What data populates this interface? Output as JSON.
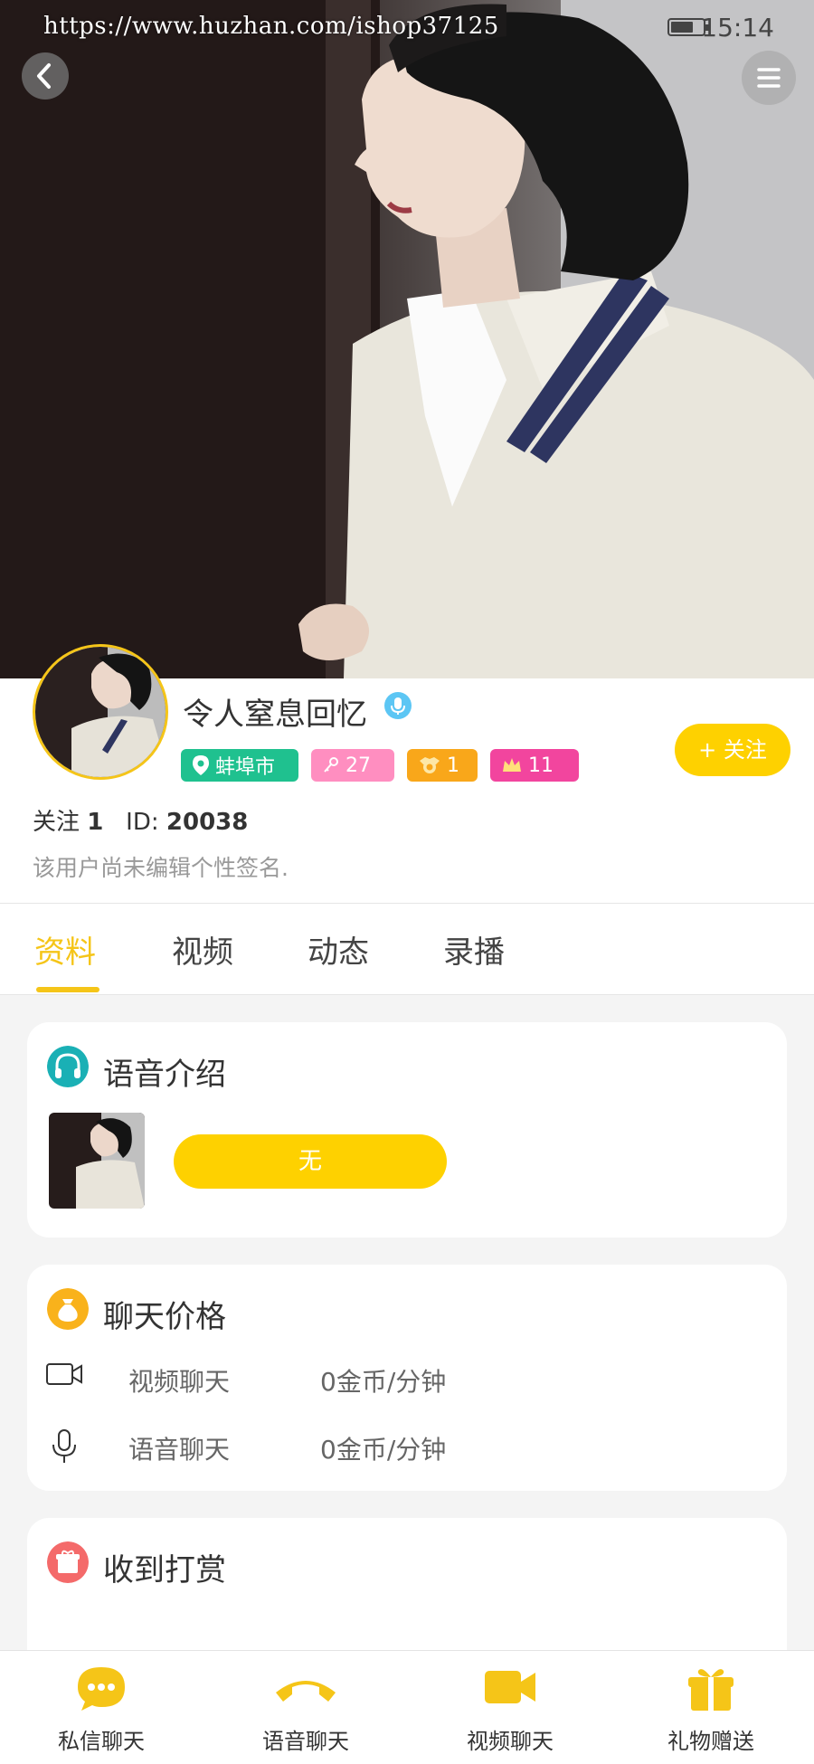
{
  "status_bar": {
    "url_watermark": "https://www.huzhan.com/ishop37125",
    "time": "15:14"
  },
  "hero": {
    "back_icon": "chevron-left-icon",
    "menu_icon": "hamburger-menu-icon"
  },
  "profile": {
    "nickname": "令人窒息回忆",
    "verified_icon": "microphone-badge-icon",
    "tags": {
      "city": "蚌埠市",
      "fans": "27",
      "level": "1",
      "crown": "11"
    },
    "follow_button": "+ 关注",
    "follow_label": "关注",
    "follow_count": "1",
    "id_label": "ID:",
    "id_value": "20038",
    "signature": "该用户尚未编辑个性签名."
  },
  "tabs": [
    "资料",
    "视频",
    "动态",
    "录播"
  ],
  "active_tab": "资料",
  "voice_intro": {
    "title": "语音介绍",
    "button": "无"
  },
  "chat_price": {
    "title": "聊天价格",
    "rows": [
      {
        "label": "视频聊天",
        "value": "0金币/分钟",
        "icon": "video-camera-icon"
      },
      {
        "label": "语音聊天",
        "value": "0金币/分钟",
        "icon": "microphone-icon"
      }
    ]
  },
  "rewards": {
    "title": "收到打赏"
  },
  "bottom_nav": [
    "私信聊天",
    "语音聊天",
    "视频聊天",
    "礼物赠送"
  ],
  "colors": {
    "accent": "#fed100",
    "active_tab": "#f5c518",
    "city_tag": "#1fc18f",
    "fans_tag": "#ff8ec0",
    "level_tag": "#f9a71a",
    "crown_tag": "#f2459e"
  }
}
